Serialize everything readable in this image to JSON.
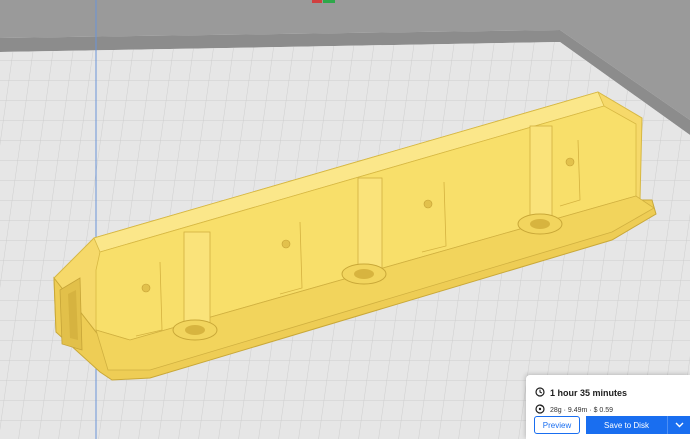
{
  "print_summary": {
    "print_time": "1 hour 35 minutes",
    "material_info": "28g · 9.49m · $ 0.59"
  },
  "actions": {
    "preview_label": "Preview",
    "save_label": "Save to Disk"
  },
  "icons": {
    "time": "clock-icon",
    "material": "spool-icon",
    "dropdown": "chevron-down-icon"
  },
  "colors": {
    "model": "#f8df6a",
    "build_plate": "#e9e9e9",
    "grid_line": "#c4c4c4",
    "accent": "#196ef0"
  }
}
